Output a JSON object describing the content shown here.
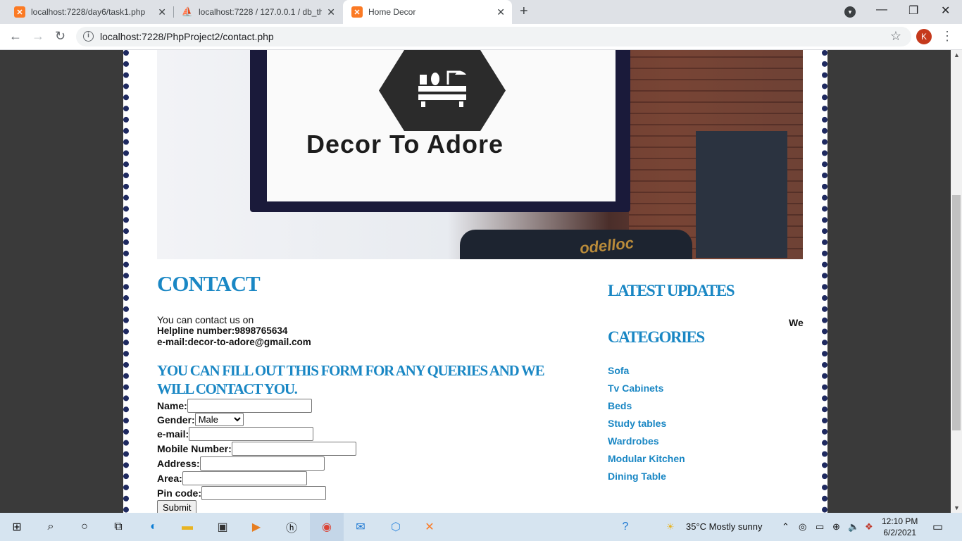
{
  "browser": {
    "tabs": [
      {
        "title": "localhost:7228/day6/task1.php",
        "icon": "xampp-icon"
      },
      {
        "title": "localhost:7228 / 127.0.0.1 / db_th",
        "icon": "phpmyadmin-icon"
      },
      {
        "title": "Home Decor",
        "icon": "xampp-icon"
      }
    ],
    "url": "localhost:7228/PhpProject2/contact.php",
    "profile_initial": "K"
  },
  "banner": {
    "brand": "Decor To Adore"
  },
  "contact": {
    "heading": "CONTACT",
    "intro": "You can contact us on",
    "helpline": "Helpline number:9898765634",
    "email": "e-mail:decor-to-adore@gmail.com",
    "form_heading": "YOU CAN FILL OUT THIS FORM FOR ANY QUERIES AND WE WILL CONTACT YOU."
  },
  "form": {
    "name_label": "Name:",
    "gender_label": "Gender:",
    "gender_selected": "Male",
    "email_label": "e-mail:",
    "mobile_label": "Mobile Number:",
    "address_label": "Address:",
    "area_label": "Area:",
    "pincode_label": "Pin code:",
    "submit_label": "Submit"
  },
  "sidebar": {
    "latest_heading": "LATEST UPDATES",
    "marquee_text": "We",
    "categories_heading": "CATEGORIES",
    "categories": [
      "Sofa",
      "Tv Cabinets",
      "Beds",
      "Study tables",
      "Wardrobes",
      "Modular Kitchen",
      "Dining Table"
    ]
  },
  "taskbar": {
    "weather": "35°C  Mostly sunny",
    "time": "12:10 PM",
    "date": "6/2/2021"
  },
  "colors": {
    "heading_blue": "#1a87c4",
    "border_navy": "#1f2a60"
  }
}
